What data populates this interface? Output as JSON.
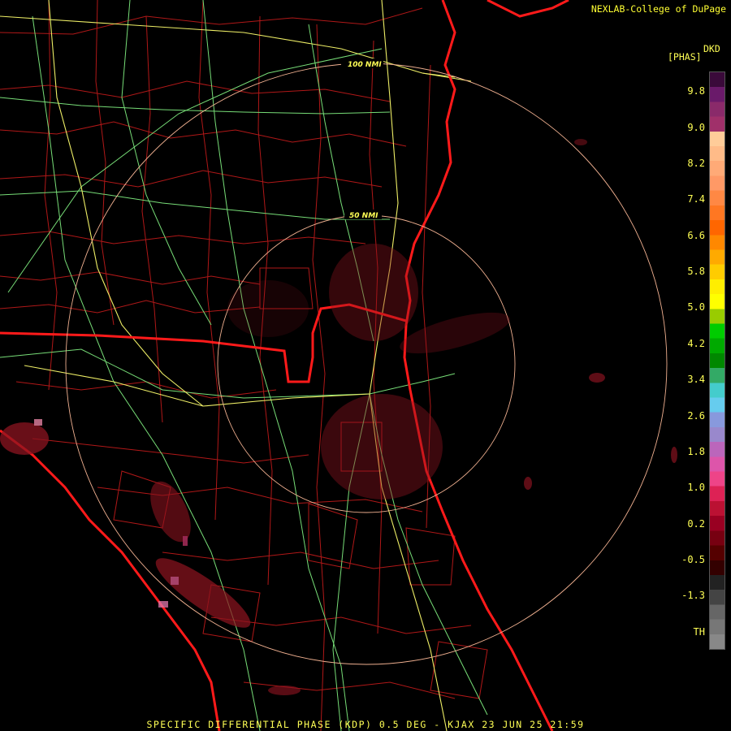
{
  "credit": "NEXLAB-College of DuPage",
  "footer": "SPECIFIC DIFFERENTIAL PHASE (KDP) 0.5 DEG - KJAX 23 JUN 25 21:59",
  "legend": {
    "unit_code": "DKD",
    "unit_name": "[PHAS]",
    "labels": [
      "9.8",
      "9.0",
      "8.2",
      "7.4",
      "6.6",
      "5.8",
      "5.0",
      "4.2",
      "3.4",
      "2.6",
      "1.8",
      "1.0",
      "0.2",
      "-0.5",
      "-1.3",
      "TH"
    ],
    "colors": [
      "#3a0a3a",
      "#6a1a6a",
      "#8a2a6a",
      "#a0306a",
      "#ffcc99",
      "#ffbb88",
      "#ffaa77",
      "#ff9966",
      "#ff8844",
      "#ff7722",
      "#ff6600",
      "#ff8800",
      "#ffaa00",
      "#ffcc00",
      "#ffee00",
      "#ffff00",
      "#99cc00",
      "#00cc00",
      "#00aa00",
      "#008800",
      "#33aa66",
      "#44cccc",
      "#66ccee",
      "#8899dd",
      "#9988cc",
      "#bb66bb",
      "#dd55aa",
      "#ee4488",
      "#dd2255",
      "#bb1133",
      "#990022",
      "#770011",
      "#550000",
      "#330000",
      "#222222",
      "#444444",
      "#666666",
      "#777777",
      "#888888"
    ]
  },
  "range_rings": [
    "100 NMI",
    "50 NMI"
  ],
  "map_colors": {
    "county_lines": "#b01818",
    "state_lines": "#ff1a1a",
    "highways": "#77dd77",
    "interstates": "#eeee66",
    "range_rings": "#f0b090",
    "echo": "#8b1420"
  }
}
